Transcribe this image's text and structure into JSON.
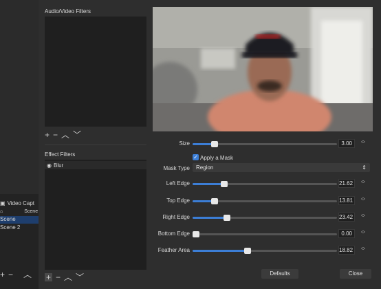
{
  "background": {
    "source_label": "Video Capt",
    "scene_header": "Scene",
    "scenes": [
      "Scene",
      "Scene 2"
    ]
  },
  "filters": {
    "av_title": "Audio/Video Filters",
    "effect_title": "Effect Filters",
    "effect_items": [
      {
        "label": "Blur"
      }
    ]
  },
  "settings": {
    "size": {
      "label": "Size",
      "value": "3.00",
      "fraction": 0.15
    },
    "apply_mask": {
      "label": "Apply a Mask",
      "checked": true
    },
    "mask_type": {
      "label": "Mask Type",
      "value": "Region"
    },
    "left_edge": {
      "label": "Left Edge",
      "value": "21.62",
      "fraction": 0.22
    },
    "top_edge": {
      "label": "Top Edge",
      "value": "13.81",
      "fraction": 0.15
    },
    "right_edge": {
      "label": "Right Edge",
      "value": "23.42",
      "fraction": 0.24
    },
    "bottom_edge": {
      "label": "Bottom Edge",
      "value": "0.00",
      "fraction": 0.0
    },
    "feather_area": {
      "label": "Feather Area",
      "value": "18.82",
      "fraction": 0.38
    }
  },
  "buttons": {
    "defaults": "Defaults",
    "close": "Close"
  },
  "colors": {
    "accent": "#3c7ed6"
  }
}
